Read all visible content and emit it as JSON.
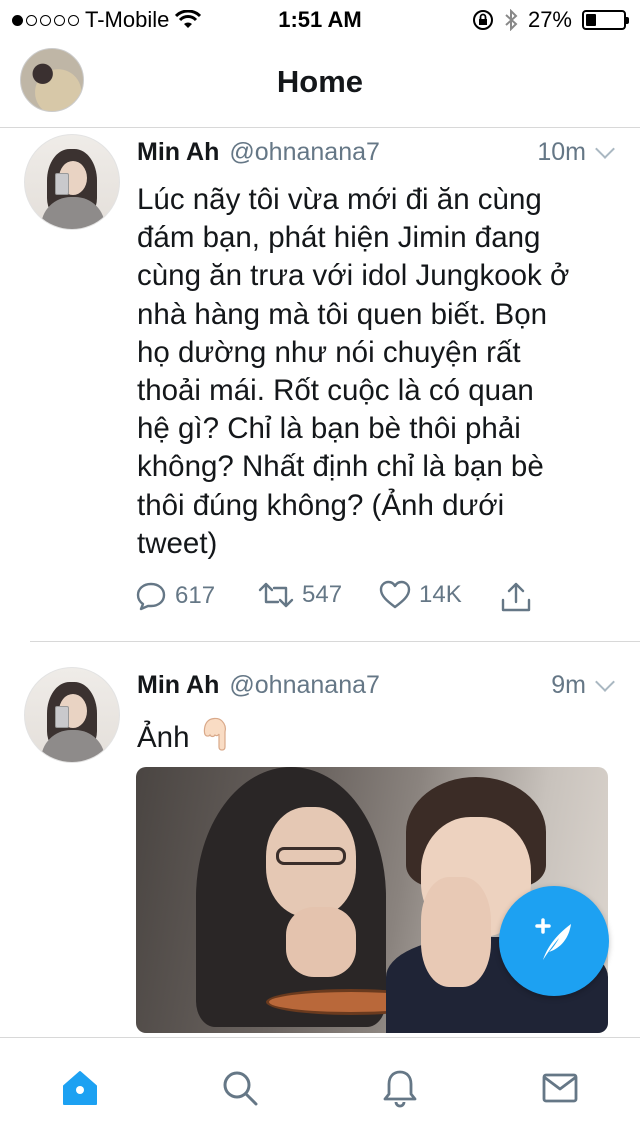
{
  "status_bar": {
    "carrier": "T-Mobile",
    "signal_bars_filled": 1,
    "signal_bars_total": 5,
    "time": "1:51 AM",
    "battery": "27%",
    "battery_fraction": 0.27
  },
  "nav": {
    "title": "Home",
    "avatar_icon": "profile-avatar"
  },
  "tweets": [
    {
      "name": "Min Ah",
      "handle": "@ohnanana7",
      "time": "10m",
      "text_lines": [
        "Lúc nãy tôi vừa mới đi ăn cùng",
        "đám bạn, phát hiện Jimin đang",
        "cùng ăn trưa với idol Jungkook ở",
        "nhà hàng mà tôi quen biết. Bọn",
        "họ dường như nói chuyện rất",
        "thoải mái. Rốt cuộc là có quan",
        "hệ gì? Chỉ là bạn bè thôi phải",
        "không? Nhất định chỉ là bạn bè",
        "thôi đúng không? (Ảnh dưới",
        "tweet)"
      ],
      "replies": "617",
      "retweets": "547",
      "likes": "14K"
    },
    {
      "name": "Min Ah",
      "handle": "@ohnanana7",
      "time": "9m",
      "text": "Ảnh",
      "emoji": "pointing-down-hand",
      "has_media": true
    }
  ],
  "icons": {
    "reply": "reply-icon",
    "retweet": "retweet-icon",
    "like": "heart-icon",
    "share": "share-icon",
    "compose": "compose-tweet-icon",
    "tabs": [
      "home-icon",
      "search-icon",
      "notifications-icon",
      "messages-icon"
    ]
  },
  "colors": {
    "accent": "#1da1f2",
    "text": "#14171a",
    "secondary": "#657786"
  }
}
